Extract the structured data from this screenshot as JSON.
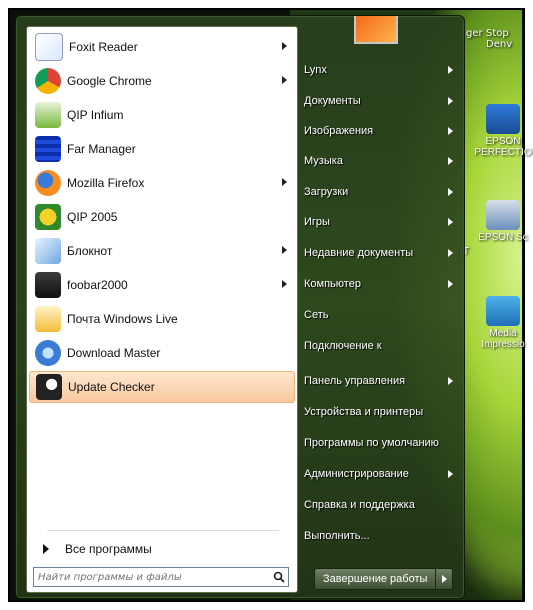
{
  "programs": [
    {
      "label": "Foxit Reader",
      "icon": "foxit-reader-icon",
      "arrow": true
    },
    {
      "label": "Google Chrome",
      "icon": "chrome-icon",
      "arrow": true
    },
    {
      "label": "QIP Infium",
      "icon": "qip-infium-icon",
      "arrow": false
    },
    {
      "label": "Far Manager",
      "icon": "far-manager-icon",
      "arrow": false
    },
    {
      "label": "Mozilla Firefox",
      "icon": "firefox-icon",
      "arrow": true
    },
    {
      "label": "QIP 2005",
      "icon": "qip-2005-icon",
      "arrow": false
    },
    {
      "label": "Блокнот",
      "icon": "notepad-icon",
      "arrow": true
    },
    {
      "label": "foobar2000",
      "icon": "foobar2000-icon",
      "arrow": true
    },
    {
      "label": "Почта Windows Live",
      "icon": "windows-live-mail-icon",
      "arrow": false
    },
    {
      "label": "Download Master",
      "icon": "download-master-icon",
      "arrow": false
    },
    {
      "label": "Update Checker",
      "icon": "update-checker-icon",
      "arrow": false
    }
  ],
  "all_programs": "Все программы",
  "search": {
    "placeholder": "Найти программы и файлы"
  },
  "right_menu": [
    {
      "label": "Lynx",
      "arrow": true
    },
    {
      "label": "Документы",
      "arrow": true
    },
    {
      "label": "Изображения",
      "arrow": true
    },
    {
      "label": "Музыка",
      "arrow": true
    },
    {
      "label": "Загрузки",
      "arrow": true
    },
    {
      "label": "Игры",
      "arrow": true
    },
    {
      "label": "Недавние документы",
      "arrow": true
    },
    {
      "label": "Компьютер",
      "arrow": true
    },
    {
      "label": "Сеть",
      "arrow": false
    },
    {
      "label": "Подключение к",
      "arrow": false
    },
    {
      "label": "Панель управления",
      "arrow": true
    },
    {
      "label": "Устройства и принтеры",
      "arrow": false
    },
    {
      "label": "Программы по умолчанию",
      "arrow": false
    },
    {
      "label": "Администрирование",
      "arrow": true
    },
    {
      "label": "Справка и поддержка",
      "arrow": false
    },
    {
      "label": "Выполнить...",
      "arrow": false
    }
  ],
  "shutdown": {
    "label": "Завершение работы"
  },
  "desktop": {
    "top_labels": [
      "ger",
      "Stop Denv"
    ],
    "icons": [
      {
        "label": "EPSON PERFECTIO"
      },
      {
        "label": "EPSON Sc"
      },
      {
        "label": "Media Impressio"
      }
    ],
    "side_labels": [
      "BT"
    ]
  },
  "colors": {
    "accent_highlight": "#f9c89f",
    "menu_bg": "#2e481e",
    "desktop_green": "#a7d63a"
  }
}
